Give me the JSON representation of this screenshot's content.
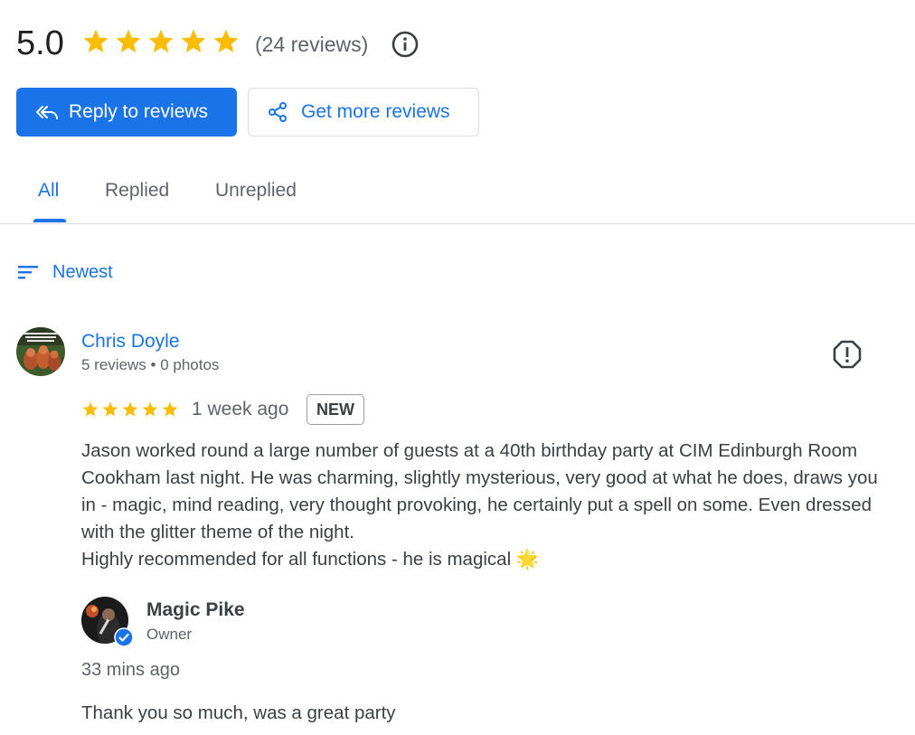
{
  "summary": {
    "rating": "5.0",
    "star_count": 5,
    "review_count": "(24 reviews)",
    "star_color": "#fbbc04"
  },
  "actions": {
    "reply_label": "Reply to reviews",
    "get_more_label": "Get more reviews",
    "accent": "#1a73e8"
  },
  "tabs": [
    {
      "label": "All",
      "active": true
    },
    {
      "label": "Replied",
      "active": false
    },
    {
      "label": "Unreplied",
      "active": false
    }
  ],
  "sort": {
    "label": "Newest",
    "icon": "sort-icon"
  },
  "review": {
    "author": "Chris Doyle",
    "meta": "5 reviews • 0 photos",
    "rating": 5,
    "time": "1 week ago",
    "badge": "NEW",
    "body_lines": [
      "Jason worked round a large number of guests at a 40th birthday party at CIM Edinburgh Room Cookham last night. He was charming, slightly mysterious, very good at what he does, draws you in - magic, mind reading, very thought provoking, he certainly put a spell on some. Even dressed with the glitter theme of the night.",
      "Highly recommended for all functions - he is magical"
    ],
    "emoji": "🌟"
  },
  "reply": {
    "name": "Magic Pike",
    "role": "Owner",
    "time": "33 mins ago",
    "text": "Thank you so much, was a great party"
  }
}
